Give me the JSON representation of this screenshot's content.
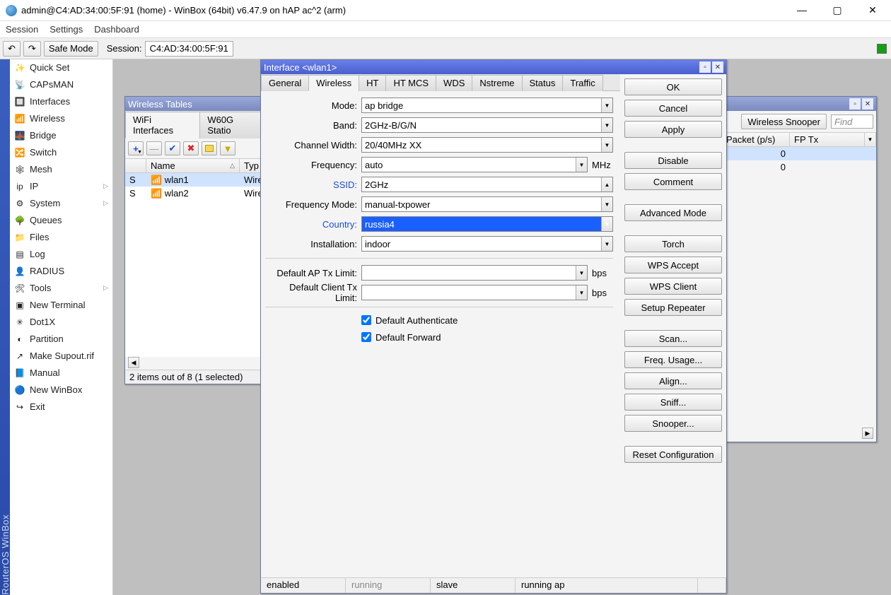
{
  "title": "admin@C4:AD:34:00:5F:91 (home) - WinBox (64bit) v6.47.9 on hAP ac^2 (arm)",
  "menubar": [
    "Session",
    "Settings",
    "Dashboard"
  ],
  "toolbar": {
    "safe_mode": "Safe Mode",
    "session_label": "Session:",
    "session_value": "C4:AD:34:00:5F:91"
  },
  "side_handle": "RouterOS WinBox",
  "sidebar": [
    {
      "label": "Quick Set",
      "icon": "wand"
    },
    {
      "label": "CAPsMAN",
      "icon": "cap"
    },
    {
      "label": "Interfaces",
      "icon": "iface"
    },
    {
      "label": "Wireless",
      "icon": "wifi"
    },
    {
      "label": "Bridge",
      "icon": "bridge"
    },
    {
      "label": "Switch",
      "icon": "switch"
    },
    {
      "label": "Mesh",
      "icon": "mesh"
    },
    {
      "label": "IP",
      "icon": "ip",
      "sub": true
    },
    {
      "label": "System",
      "icon": "sys",
      "sub": true
    },
    {
      "label": "Queues",
      "icon": "queue"
    },
    {
      "label": "Files",
      "icon": "folder"
    },
    {
      "label": "Log",
      "icon": "log"
    },
    {
      "label": "RADIUS",
      "icon": "radius"
    },
    {
      "label": "Tools",
      "icon": "tools",
      "sub": true
    },
    {
      "label": "New Terminal",
      "icon": "term"
    },
    {
      "label": "Dot1X",
      "icon": "dot1x"
    },
    {
      "label": "Partition",
      "icon": "part"
    },
    {
      "label": "Make Supout.rif",
      "icon": "supout"
    },
    {
      "label": "Manual",
      "icon": "manual"
    },
    {
      "label": "New WinBox",
      "icon": "winbox"
    },
    {
      "label": "Exit",
      "icon": "exit"
    }
  ],
  "wtables": {
    "title": "Wireless Tables",
    "tabs": [
      "WiFi Interfaces",
      "W60G Statio"
    ],
    "cols": [
      "",
      "Name",
      "Typ"
    ],
    "rows": [
      {
        "flag": "S",
        "name": "wlan1",
        "type": "Wire",
        "sel": true
      },
      {
        "flag": "S",
        "name": "wlan2",
        "type": "Wire",
        "sel": false
      }
    ],
    "status": "2 items out of 8 (1 selected)"
  },
  "rightwin": {
    "buttons": [
      "Wireless Snooper"
    ],
    "find": "Find",
    "cols": [
      "Packet (p/s)",
      "FP Tx"
    ],
    "rows": [
      {
        "v": "0"
      },
      {
        "v": "0"
      }
    ]
  },
  "iface": {
    "title": "Interface <wlan1>",
    "tabs": [
      "General",
      "Wireless",
      "HT",
      "HT MCS",
      "WDS",
      "Nstreme",
      "Status",
      "Traffic"
    ],
    "active_tab": 1,
    "fields": {
      "mode": {
        "label": "Mode:",
        "value": "ap bridge"
      },
      "band": {
        "label": "Band:",
        "value": "2GHz-B/G/N"
      },
      "chw": {
        "label": "Channel Width:",
        "value": "20/40MHz XX"
      },
      "freq": {
        "label": "Frequency:",
        "value": "auto",
        "unit": "MHz"
      },
      "ssid": {
        "label": "SSID:",
        "value": "2GHz",
        "link": true,
        "up": true
      },
      "fmode": {
        "label": "Frequency Mode:",
        "value": "manual-txpower"
      },
      "country": {
        "label": "Country:",
        "value": "russia4",
        "link": true,
        "sel": true
      },
      "inst": {
        "label": "Installation:",
        "value": "indoor"
      },
      "aptx": {
        "label": "Default AP Tx Limit:",
        "value": "",
        "unit": "bps"
      },
      "cltx": {
        "label": "Default Client Tx Limit:",
        "value": "",
        "unit": "bps"
      }
    },
    "checks": {
      "auth": "Default Authenticate",
      "fwd": "Default Forward"
    },
    "buttons": [
      "OK",
      "Cancel",
      "Apply",
      "Disable",
      "Comment",
      "Advanced Mode",
      "Torch",
      "WPS Accept",
      "WPS Client",
      "Setup Repeater",
      "Scan...",
      "Freq. Usage...",
      "Align...",
      "Sniff...",
      "Snooper...",
      "Reset Configuration"
    ],
    "status": [
      "enabled",
      "running",
      "slave",
      "running ap"
    ]
  }
}
